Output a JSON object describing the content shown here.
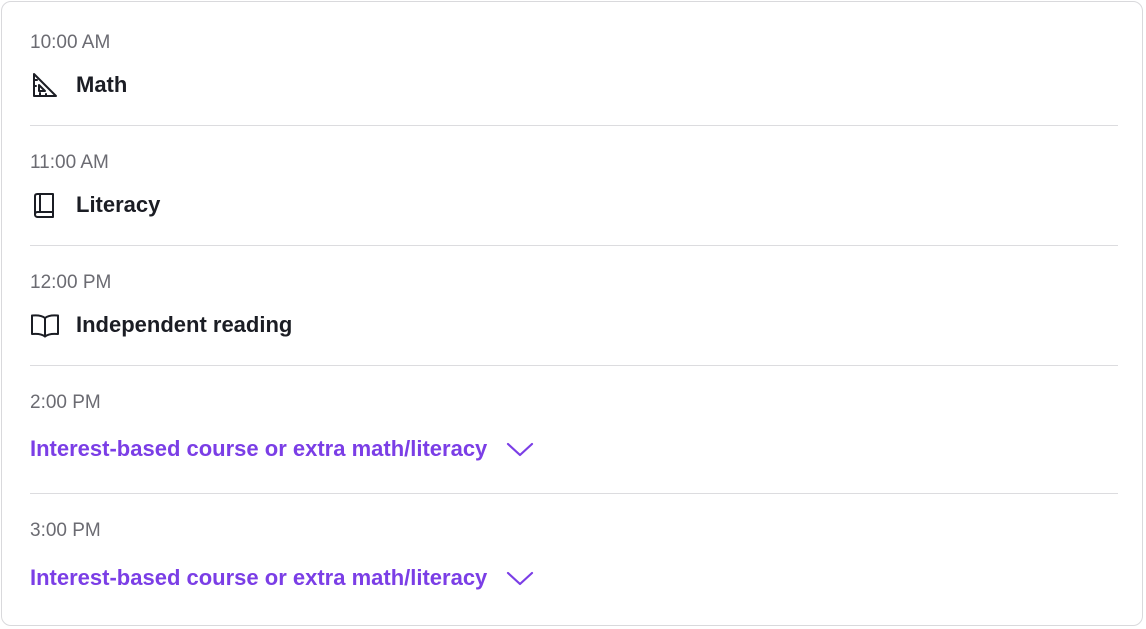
{
  "accent_color": "#7b3ee6",
  "schedule": [
    {
      "time": "10:00 AM",
      "label": "Math",
      "icon": "triangle-ruler-icon",
      "type": "subject"
    },
    {
      "time": "11:00 AM",
      "label": "Literacy",
      "icon": "book-icon",
      "type": "subject"
    },
    {
      "time": "12:00 PM",
      "label": "Independent reading",
      "icon": "open-book-icon",
      "type": "subject"
    },
    {
      "time": "2:00 PM",
      "label": "Interest-based course or extra math/literacy",
      "icon": "chevron-down-icon",
      "type": "expandable"
    },
    {
      "time": "3:00 PM",
      "label": "Interest-based course or extra math/literacy",
      "icon": "chevron-down-icon",
      "type": "expandable"
    }
  ]
}
